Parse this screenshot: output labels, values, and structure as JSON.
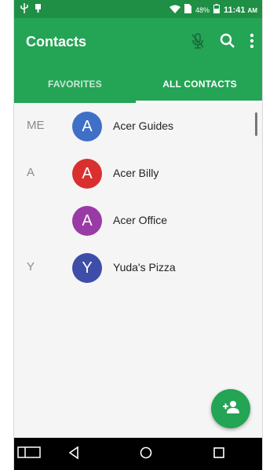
{
  "status_bar": {
    "battery": "48%",
    "time": "11:41",
    "ampm": "AM"
  },
  "app_bar": {
    "title": "Contacts",
    "icons": [
      "mic-off-icon",
      "search-icon",
      "more-vert-icon"
    ]
  },
  "tabs": [
    {
      "label": "FAVORITES",
      "selected": false
    },
    {
      "label": "ALL CONTACTS",
      "selected": true
    }
  ],
  "contacts": [
    {
      "section": "ME",
      "letter": "A",
      "name": "Acer Guides",
      "color": "#3f6fc7"
    },
    {
      "section": "A",
      "letter": "A",
      "name": "Acer Billy",
      "color": "#d9302f"
    },
    {
      "section": "",
      "letter": "A",
      "name": "Acer Office",
      "color": "#9a3aa6"
    },
    {
      "section": "Y",
      "letter": "Y",
      "name": "Yuda's Pizza",
      "color": "#3e4ea8"
    }
  ],
  "fab": {
    "icon": "add-contact-icon"
  },
  "colors": {
    "primary": "#24a455",
    "status_bar": "#1e8f45"
  }
}
